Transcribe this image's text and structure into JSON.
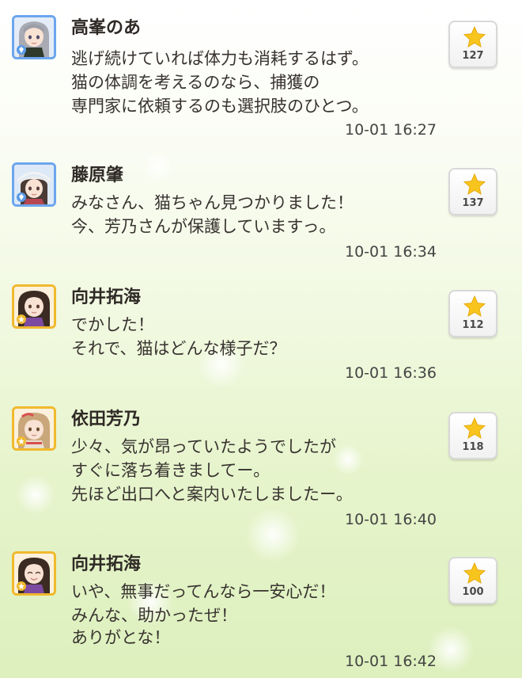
{
  "messages": [
    {
      "name": "高峯のあ",
      "lines": [
        "逃げ続けていれば体力も消耗するはず。",
        "猫の体調を考えるのなら、捕獲の",
        "専門家に依頼するのも選択肢のひとつ。"
      ],
      "time": "10-01 16:27",
      "likes": "127",
      "avatar_frame": "blue",
      "badge_icon": "gem-icon"
    },
    {
      "name": "藤原肇",
      "lines": [
        "みなさん、猫ちゃん見つかりました！",
        "今、芳乃さんが保護していますっ。"
      ],
      "time": "10-01 16:34",
      "likes": "137",
      "avatar_frame": "blue",
      "badge_icon": "gem-icon"
    },
    {
      "name": "向井拓海",
      "lines": [
        "でかした！",
        "それで、猫はどんな様子だ？"
      ],
      "time": "10-01 16:36",
      "likes": "112",
      "avatar_frame": "gold",
      "badge_icon": "star-badge-icon"
    },
    {
      "name": "依田芳乃",
      "lines": [
        "少々、気が昂っていたようでしたが",
        "すぐに落ち着きましてー。",
        "先ほど出口へと案内いたしましたー。"
      ],
      "time": "10-01 16:40",
      "likes": "118",
      "avatar_frame": "gold",
      "badge_icon": "star-badge-icon"
    },
    {
      "name": "向井拓海",
      "lines": [
        "いや、無事だってんなら一安心だ！",
        "みんな、助かったぜ！",
        "ありがとな！"
      ],
      "time": "10-01 16:42",
      "likes": "100",
      "avatar_frame": "gold",
      "badge_icon": "star-badge-icon"
    }
  ],
  "colors": {
    "like_star": "#f7c51e",
    "frame_blue": "#6ca6ee",
    "frame_gold": "#f0b92e"
  }
}
